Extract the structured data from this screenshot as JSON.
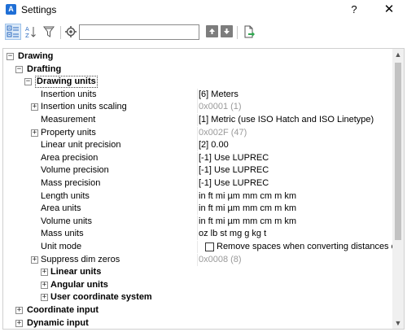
{
  "window": {
    "title": "Settings",
    "app_icon_letter": "A",
    "help_label": "?",
    "close_label": "✕"
  },
  "toolbar": {
    "search_value": "",
    "search_placeholder": ""
  },
  "tree": {
    "rows": [
      {
        "name": "Drawing",
        "value": "",
        "bold": true,
        "expander": "−",
        "gray": false
      },
      {
        "name": "Drafting",
        "value": "",
        "bold": true,
        "expander": "−",
        "gray": false
      },
      {
        "name": "Drawing units",
        "value": "",
        "bold": true,
        "expander": "−",
        "gray": false
      },
      {
        "name": "Insertion units",
        "value": "[6] Meters",
        "bold": false,
        "expander": "",
        "gray": false
      },
      {
        "name": "Insertion units scaling",
        "value": "0x0001 (1)",
        "bold": false,
        "expander": "+",
        "gray": true
      },
      {
        "name": "Measurement",
        "value": "[1] Metric (use ISO Hatch and ISO Linetype)",
        "bold": false,
        "expander": "",
        "gray": false
      },
      {
        "name": "Property units",
        "value": "0x002F (47)",
        "bold": false,
        "expander": "+",
        "gray": true
      },
      {
        "name": "Linear unit precision",
        "value": "[2] 0.00",
        "bold": false,
        "expander": "",
        "gray": false
      },
      {
        "name": "Area precision",
        "value": "[-1] Use LUPREC",
        "bold": false,
        "expander": "",
        "gray": false
      },
      {
        "name": "Volume precision",
        "value": "[-1] Use LUPREC",
        "bold": false,
        "expander": "",
        "gray": false
      },
      {
        "name": "Mass precision",
        "value": "[-1] Use LUPREC",
        "bold": false,
        "expander": "",
        "gray": false
      },
      {
        "name": "Length units",
        "value": "in ft mi µm mm cm m km",
        "bold": false,
        "expander": "",
        "gray": false
      },
      {
        "name": "Area units",
        "value": "in ft mi µm mm cm m km",
        "bold": false,
        "expander": "",
        "gray": false
      },
      {
        "name": "Volume units",
        "value": "in ft mi µm mm cm m km",
        "bold": false,
        "expander": "",
        "gray": false
      },
      {
        "name": "Mass units",
        "value": "oz lb st mg g kg t",
        "bold": false,
        "expander": "",
        "gray": false
      },
      {
        "name": "Unit mode",
        "value": "Remove spaces when converting distances or angles",
        "bold": false,
        "expander": "",
        "gray": false
      },
      {
        "name": "Suppress dim zeros",
        "value": "0x0008 (8)",
        "bold": false,
        "expander": "+",
        "gray": true
      },
      {
        "name": "Linear units",
        "value": "",
        "bold": true,
        "expander": "+",
        "gray": false
      },
      {
        "name": "Angular units",
        "value": "",
        "bold": true,
        "expander": "+",
        "gray": false
      },
      {
        "name": "User coordinate system",
        "value": "",
        "bold": true,
        "expander": "+",
        "gray": false
      },
      {
        "name": "Coordinate input",
        "value": "",
        "bold": true,
        "expander": "+",
        "gray": false
      },
      {
        "name": "Dynamic input",
        "value": "",
        "bold": true,
        "expander": "+",
        "gray": false
      }
    ],
    "unit_mode_checked": false
  },
  "colors": {
    "accent": "#1f6fd6",
    "gray_value": "#9a9a9a",
    "selection_bg": "#dbe9f8"
  }
}
